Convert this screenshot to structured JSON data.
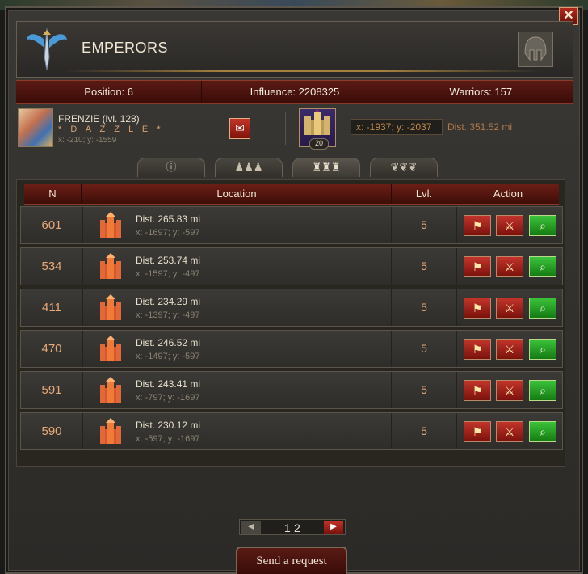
{
  "window": {
    "title": "EMPERORS",
    "close_label": "✕"
  },
  "stats": {
    "position_label": "Position:",
    "position_value": "6",
    "influence_label": "Influence:",
    "influence_value": "2208325",
    "warriors_label": "Warriors:",
    "warriors_value": "157"
  },
  "player": {
    "name": "FRENZIE (lvl. 128)",
    "clan": "* D A Z Z L E *",
    "coords": "x: -210; y: -1559",
    "castle_level": "20",
    "target_coords": "x: -1937; y: -2037",
    "target_distance": "Dist. 351.52 mi"
  },
  "tabs": [
    "ⓘ",
    "♟♟♟",
    "♜♜♜",
    "❦❦❦"
  ],
  "table": {
    "headers": [
      "N",
      "Location",
      "Lvl.",
      "Action"
    ],
    "rows": [
      {
        "n": "601",
        "dist": "Dist. 265.83 mi",
        "coords": "x: -1697; y: -597",
        "lvl": "5"
      },
      {
        "n": "534",
        "dist": "Dist. 253.74 mi",
        "coords": "x: -1597; y: -497",
        "lvl": "5"
      },
      {
        "n": "411",
        "dist": "Dist. 234.29 mi",
        "coords": "x: -1397; y: -497",
        "lvl": "5"
      },
      {
        "n": "470",
        "dist": "Dist. 246.52 mi",
        "coords": "x: -1497; y: -597",
        "lvl": "5"
      },
      {
        "n": "591",
        "dist": "Dist. 243.41 mi",
        "coords": "x: -797; y: -1697",
        "lvl": "5"
      },
      {
        "n": "590",
        "dist": "Dist. 230.12 mi",
        "coords": "x: -597; y: -1697",
        "lvl": "5"
      }
    ]
  },
  "pager": {
    "pages": [
      "1",
      "2"
    ],
    "prev_label": "◀",
    "next_label": "▶"
  },
  "send_request_label": "Send a request"
}
